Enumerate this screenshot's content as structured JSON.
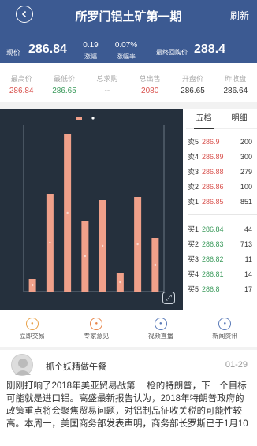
{
  "header": {
    "title": "所罗门铝土矿第一期",
    "refresh": "刷新",
    "price_label": "现价",
    "price": "286.84",
    "change": "0.19",
    "change_label": "涨幅",
    "change_rate": "0.07%",
    "change_rate_label": "涨幅率",
    "buyback_label": "最终回购价",
    "buyback": "288.4"
  },
  "stats": [
    {
      "label": "最高价",
      "value": "286.84",
      "color": "#d9534f"
    },
    {
      "label": "最低价",
      "value": "286.65",
      "color": "#3a9a5b"
    },
    {
      "label": "总求购",
      "value": "--",
      "color": "#777777"
    },
    {
      "label": "总出售",
      "value": "2080",
      "color": "#d9534f"
    },
    {
      "label": "开盘价",
      "value": "286.65",
      "color": "#333333"
    },
    {
      "label": "昨收盘",
      "value": "286.64",
      "color": "#333333"
    }
  ],
  "orderbook": {
    "tab_active": "五档",
    "tab_other": "明细",
    "sell": [
      {
        "name": "卖5",
        "price": "286.9",
        "qty": "200"
      },
      {
        "name": "卖4",
        "price": "286.89",
        "qty": "300"
      },
      {
        "name": "卖3",
        "price": "286.88",
        "qty": "279"
      },
      {
        "name": "卖2",
        "price": "286.86",
        "qty": "100"
      },
      {
        "name": "卖1",
        "price": "286.85",
        "qty": "851"
      }
    ],
    "buy": [
      {
        "name": "买1",
        "price": "286.84",
        "qty": "44"
      },
      {
        "name": "买2",
        "price": "286.83",
        "qty": "713"
      },
      {
        "name": "买3",
        "price": "286.82",
        "qty": "11"
      },
      {
        "name": "买4",
        "price": "286.81",
        "qty": "14"
      },
      {
        "name": "买5",
        "price": "286.8",
        "qty": "17"
      }
    ],
    "sell_color": "#d9534f",
    "buy_color": "#3a9a5b"
  },
  "actions": [
    {
      "label": "立即交易",
      "icon": "trade-icon",
      "color": "#e8a24a"
    },
    {
      "label": "专家意见",
      "icon": "expert-icon",
      "color": "#e8864a"
    },
    {
      "label": "视频直播",
      "icon": "video-icon",
      "color": "#5a7ab8"
    },
    {
      "label": "新闻资讯",
      "icon": "news-icon",
      "color": "#5a7ab8"
    }
  ],
  "post": {
    "author": "抓个妖精做午餐",
    "date": "01-29",
    "text": "刚刚打响了2018年美亚贸易战第 一枪的特朗普，下一个目标可能就是进口铝。高盛最新报告认为，2018年特朗普政府的政策重点将会聚焦贸易问题，对铝制品征收关税的可能性较高。本周一，美国商务部发表声明，商务部长罗斯已于1月10"
  },
  "chart_data": {
    "type": "bar",
    "values": [
      8,
      62,
      100,
      45,
      58,
      12,
      60,
      34
    ],
    "bar_color": "#f0a08a"
  }
}
